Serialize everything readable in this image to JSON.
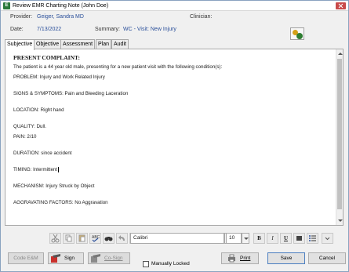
{
  "window": {
    "title": "Review EMR Charting Note (John Doe)"
  },
  "header": {
    "provider_label": "Provider:",
    "provider_value": "Geiger, Sandra  MD",
    "clinician_label": "Clinician:",
    "date_label": "Date:",
    "date_value": "7/13/2022",
    "summary_label": "Summary:",
    "summary_value": "WC - Visit: New Injury"
  },
  "tabs": [
    {
      "label": "Subjective",
      "active": true
    },
    {
      "label": "Objective",
      "active": false
    },
    {
      "label": "Assessment",
      "active": false
    },
    {
      "label": "Plan",
      "active": false
    },
    {
      "label": "Audit",
      "active": false
    }
  ],
  "note": {
    "heading": "PRESENT COMPLAINT:",
    "lines": [
      "The patient is a 44 year old male, presenting for a new patient visit with the following condition(s):",
      "PROBLEM: Injury and Work Related Injury",
      "SIGNS & SYMPTOMS: Pain and Bleeding Laceration",
      "LOCATION: Right hand",
      "QUALITY: Dull.",
      "PAIN: 2/10",
      "DURATION: since accident",
      "TIMING: Intermittent",
      "MECHANISM: Injury Struck by Object",
      "AGGRAVATING FACTORS: No Aggravation"
    ]
  },
  "toolbar": {
    "font_name": "Calibri",
    "font_size": "10",
    "bold": "B",
    "italic": "I",
    "underline": "U",
    "icons": [
      "cut-icon",
      "copy-icon",
      "paste-icon",
      "spellcheck-icon",
      "find-icon",
      "undo-icon",
      "redo-icon",
      "highlight-icon",
      "bullet-list-icon",
      "more-icon"
    ]
  },
  "actions": {
    "code_em": "Code E&M",
    "sign": "Sign",
    "co_sign": "Co-Sign",
    "manually_locked": "Manually Locked",
    "print": "Print",
    "save": "Save",
    "cancel": "Cancel"
  },
  "colors": {
    "value_text": "#2a4f9a",
    "title_icon": "#2b7a3c",
    "close": "#c94a4a"
  }
}
